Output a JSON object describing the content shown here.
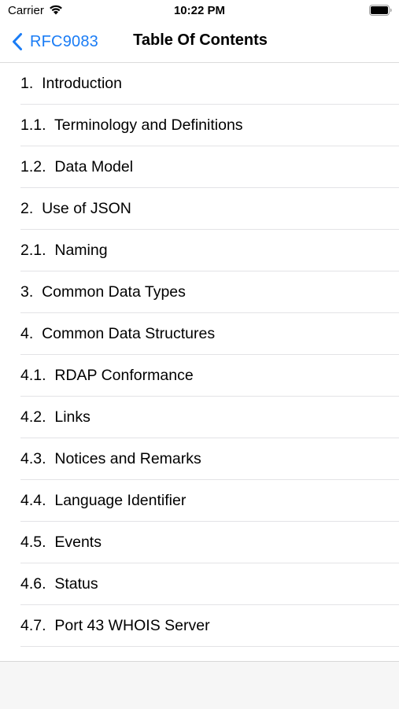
{
  "status_bar": {
    "carrier": "Carrier",
    "time": "10:22 PM"
  },
  "nav": {
    "back_label": "RFC9083",
    "title": "Table Of Contents",
    "accent_color": "#1a7cf5"
  },
  "toc": [
    {
      "label": "1.  Introduction"
    },
    {
      "label": "1.1.  Terminology and Definitions"
    },
    {
      "label": "1.2.  Data Model"
    },
    {
      "label": "2.  Use of JSON"
    },
    {
      "label": "2.1.  Naming"
    },
    {
      "label": "3.  Common Data Types"
    },
    {
      "label": "4.  Common Data Structures"
    },
    {
      "label": "4.1.  RDAP Conformance"
    },
    {
      "label": "4.2.  Links"
    },
    {
      "label": "4.3.  Notices and Remarks"
    },
    {
      "label": "4.4.  Language Identifier"
    },
    {
      "label": "4.5.  Events"
    },
    {
      "label": "4.6.  Status"
    },
    {
      "label": "4.7.  Port 43 WHOIS Server"
    }
  ]
}
